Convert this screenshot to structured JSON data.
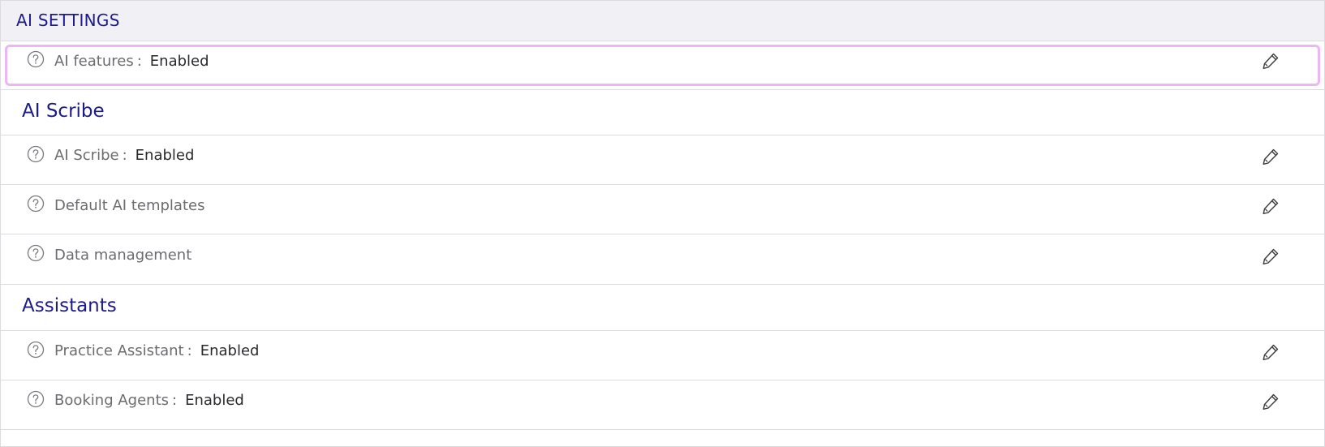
{
  "header": {
    "title": "AI SETTINGS"
  },
  "rows": [
    {
      "label": "AI features",
      "colon": ":",
      "value": "Enabled"
    }
  ],
  "sections": [
    {
      "title": "AI Scribe",
      "rows": [
        {
          "label": "AI Scribe",
          "colon": ":",
          "value": "Enabled"
        },
        {
          "label": "Default AI templates"
        },
        {
          "label": "Data management"
        }
      ]
    },
    {
      "title": "Assistants",
      "rows": [
        {
          "label": "Practice Assistant",
          "colon": ":",
          "value": "Enabled"
        },
        {
          "label": "Booking Agents",
          "colon": ":",
          "value": "Enabled"
        }
      ]
    }
  ],
  "icons": {
    "help": "question-circle-icon",
    "edit": "pencil-icon"
  },
  "colors": {
    "title": "#1d1b8a",
    "label": "#6c6c70",
    "value": "#2a2a2e",
    "focus_ring": "#ecb6f5",
    "header_bg": "#f1f0f5",
    "border": "#dcdce0"
  }
}
